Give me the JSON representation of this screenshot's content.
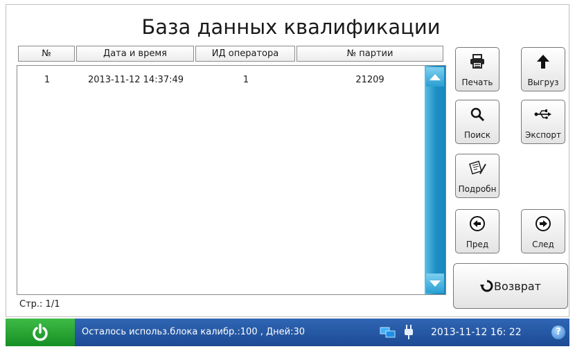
{
  "title": "База данных квалификации",
  "columns": [
    "№",
    "Дата и время",
    "ИД оператора",
    "№ партии"
  ],
  "rows": [
    {
      "num": "1",
      "datetime": "2013-11-12 14:37:49",
      "operator": "1",
      "batch": "21209"
    }
  ],
  "page_info": "Стр.: 1/1",
  "buttons": {
    "print": "Печать",
    "upload": "Выгруз",
    "search": "Поиск",
    "export": "Экспорт",
    "details": "Подробн",
    "prev": "Пред",
    "next": "След",
    "back": "Возврат"
  },
  "status": {
    "message": "Осталось использ.блока калибр.:100 , Дней:30",
    "datetime": "2013-11-12  16: 22",
    "help": "?"
  },
  "colors": {
    "scroll": "#1c8fc4",
    "statusbar": "#1d4a93",
    "power": "#22a22f"
  }
}
